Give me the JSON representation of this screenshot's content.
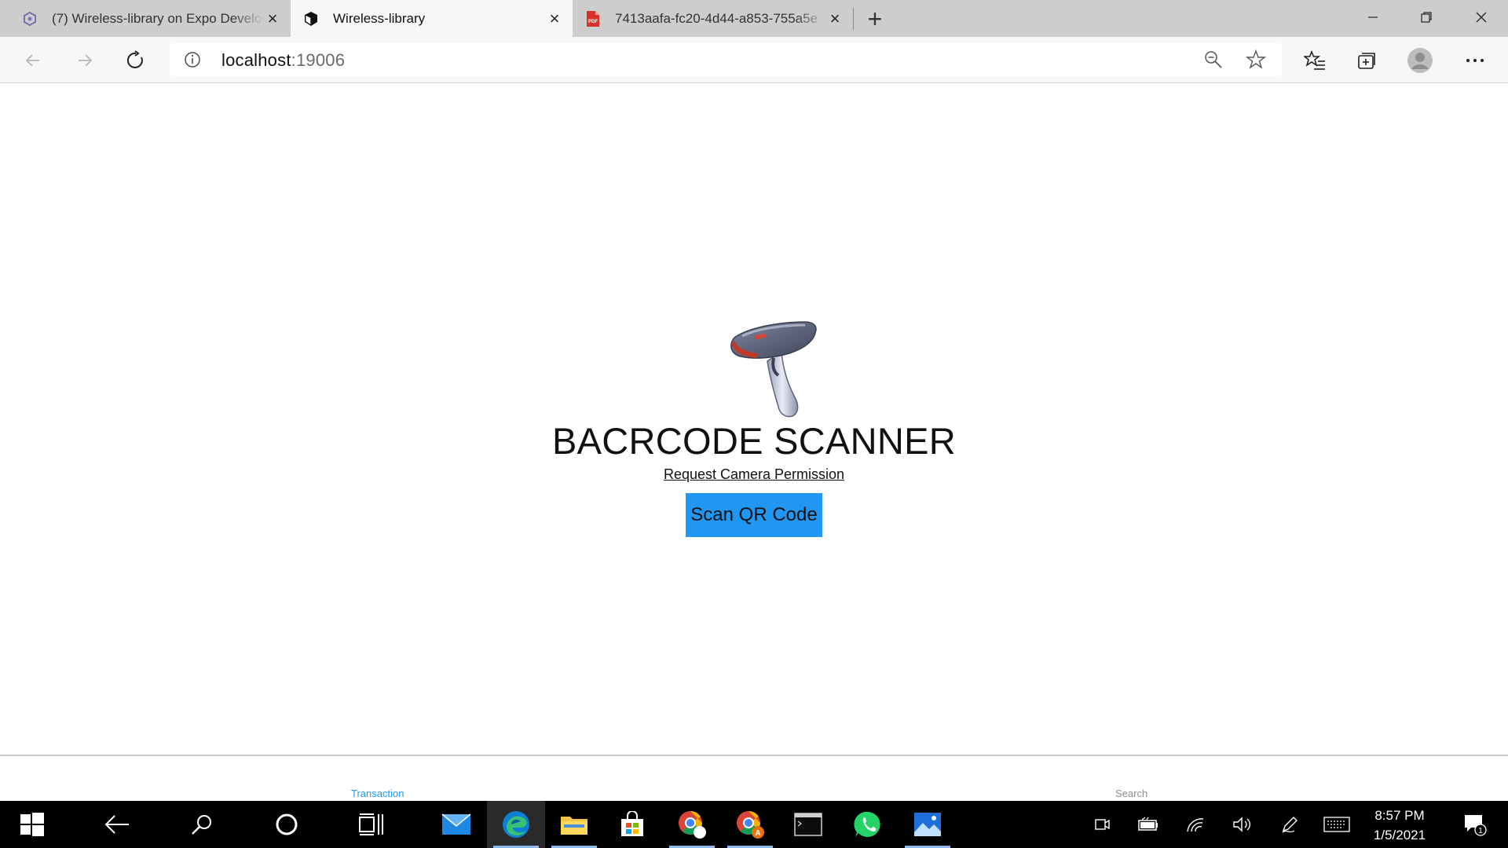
{
  "tabs": [
    {
      "title": "(7) Wireless-library on Expo Developer",
      "icon": "expo-icon",
      "active": false
    },
    {
      "title": "Wireless-library",
      "icon": "expo-cube-icon",
      "active": true
    },
    {
      "title": "7413aafa-fc20-4d44-a853-755a5e",
      "icon": "pdf-icon",
      "active": false
    }
  ],
  "address_bar": {
    "host": "localhost",
    "port": ":19006"
  },
  "page": {
    "title": "BACRCODE SCANNER",
    "permission_link": "Request Camera Permission",
    "scan_button": "Scan QR Code",
    "image": "barcode-scanner-icon"
  },
  "bottom_nav": [
    {
      "label": "Transaction",
      "active": true
    },
    {
      "label": "Search",
      "active": false
    }
  ],
  "taskbar": {
    "apps": [
      "start-icon",
      "back-icon",
      "search-icon",
      "cortana-icon",
      "task-view-icon",
      "mail-icon",
      "edge-icon",
      "file-explorer-icon",
      "store-icon",
      "chrome-icon",
      "chrome-profile-icon",
      "terminal-icon",
      "whatsapp-icon",
      "photos-icon"
    ],
    "time": "8:57 PM",
    "date": "1/5/2021",
    "notification_count": "1"
  },
  "colors": {
    "accent": "#2196f3",
    "tab_strip": "#cdcdcd",
    "toolbar": "#f7f7f7",
    "taskbar": "#000000"
  }
}
